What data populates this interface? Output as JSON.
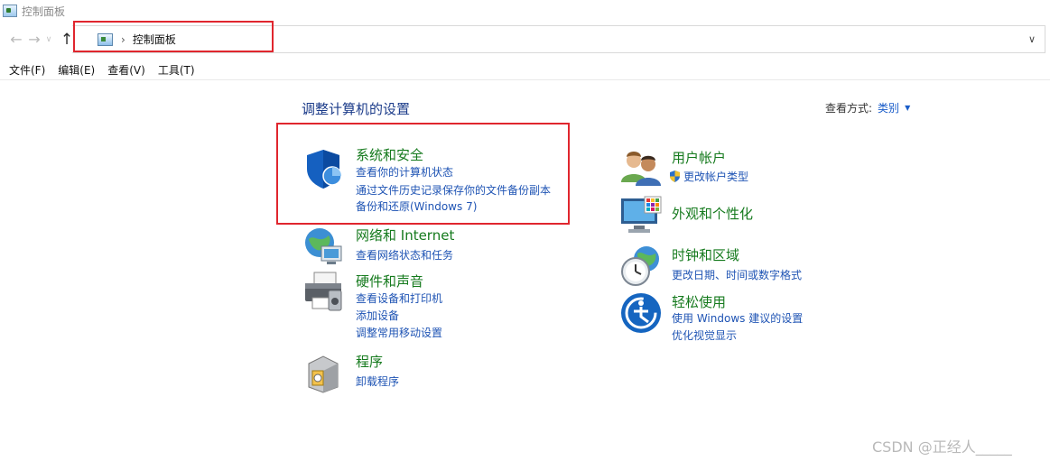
{
  "window": {
    "title": "控制面板"
  },
  "nav": {
    "back_glyph": "←",
    "forward_glyph": "→",
    "recent_glyph": "∨",
    "up_glyph": "↑",
    "address_separator": "›",
    "address_crumb": "控制面板",
    "address_dropdown_glyph": "∨"
  },
  "menu": [
    "文件(F)",
    "编辑(E)",
    "查看(V)",
    "工具(T)"
  ],
  "main": {
    "heading": "调整计算机的设置",
    "view_by_label": "查看方式:",
    "view_by_value": "类别",
    "view_by_arrow": "▼"
  },
  "categories": {
    "system_security": {
      "title": "系统和安全",
      "links": [
        "查看你的计算机状态",
        "通过文件历史记录保存你的文件备份副本",
        "备份和还原(Windows 7)"
      ]
    },
    "network_internet": {
      "title": "网络和 Internet",
      "links": [
        "查看网络状态和任务"
      ]
    },
    "hardware_sound": {
      "title": "硬件和声音",
      "links": [
        "查看设备和打印机",
        "添加设备",
        "调整常用移动设置"
      ]
    },
    "programs": {
      "title": "程序",
      "links": [
        "卸载程序"
      ]
    },
    "user_accounts": {
      "title": "用户帐户",
      "links": [
        "更改帐户类型"
      ]
    },
    "appearance": {
      "title": "外观和个性化",
      "links": []
    },
    "clock_region": {
      "title": "时钟和区域",
      "links": [
        "更改日期、时间或数字格式"
      ]
    },
    "ease_of_access": {
      "title": "轻松使用",
      "links": [
        "使用 Windows 建议的设置",
        "优化视觉显示"
      ]
    }
  },
  "watermark": "CSDN @正经人_____"
}
